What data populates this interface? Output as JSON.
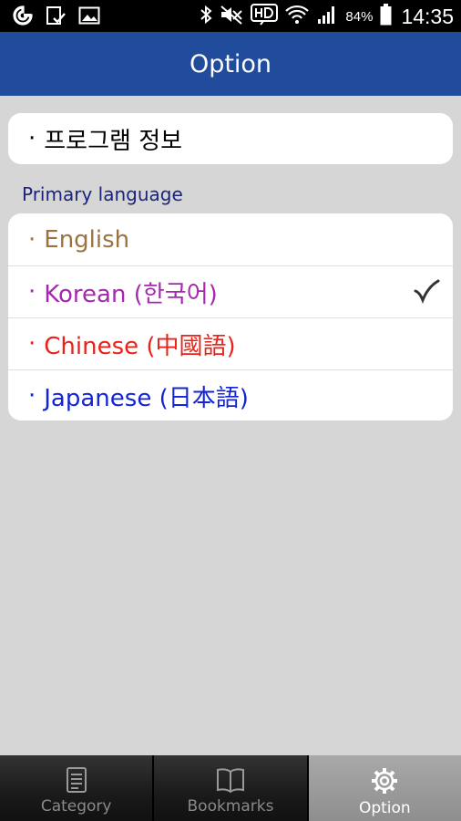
{
  "status_bar": {
    "battery_percent": "84%",
    "time": "14:35",
    "hd_badge": "HD"
  },
  "header": {
    "title": "Option"
  },
  "info_card": {
    "bullet": "·",
    "label": "프로그램 정보"
  },
  "primary_language": {
    "section_label": "Primary language",
    "items": [
      {
        "bullet": "·",
        "label": "English",
        "color": "#9a7440",
        "selected": false
      },
      {
        "bullet": "·",
        "label": "Korean (한국어)",
        "color": "#a428b0",
        "selected": true
      },
      {
        "bullet": "·",
        "label": "Chinese (中國語)",
        "color": "#e8231a",
        "selected": false
      },
      {
        "bullet": "·",
        "label": "Japanese (日本語)",
        "color": "#1424d4",
        "selected": false
      }
    ]
  },
  "tab_bar": {
    "tabs": [
      {
        "label": "Category",
        "icon": "document-icon",
        "active": false
      },
      {
        "label": "Bookmarks",
        "icon": "book-icon",
        "active": false
      },
      {
        "label": "Option",
        "icon": "gear-icon",
        "active": true
      }
    ]
  },
  "colors": {
    "header_bg": "#214b9b",
    "page_bg": "#d6d6d6",
    "section_label": "#1a237e"
  }
}
